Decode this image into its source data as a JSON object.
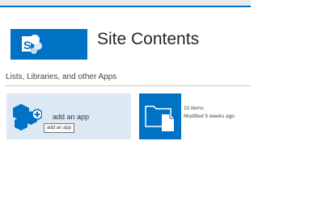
{
  "header": {
    "title": "Site Contents",
    "logo_icon": "sharepoint-logo-icon",
    "accent": "#0072c6"
  },
  "section": {
    "heading": "Lists, Libraries, and other Apps"
  },
  "tiles": {
    "add_app": {
      "label": "add an app",
      "tooltip": "add an app",
      "icon": "add-app-icon",
      "background": "#dce9f5"
    },
    "list": {
      "icon": "folder-document-icon",
      "item_count": "10 items",
      "modified": "Modified 5 weeks ago",
      "background": "#0072c6"
    }
  }
}
